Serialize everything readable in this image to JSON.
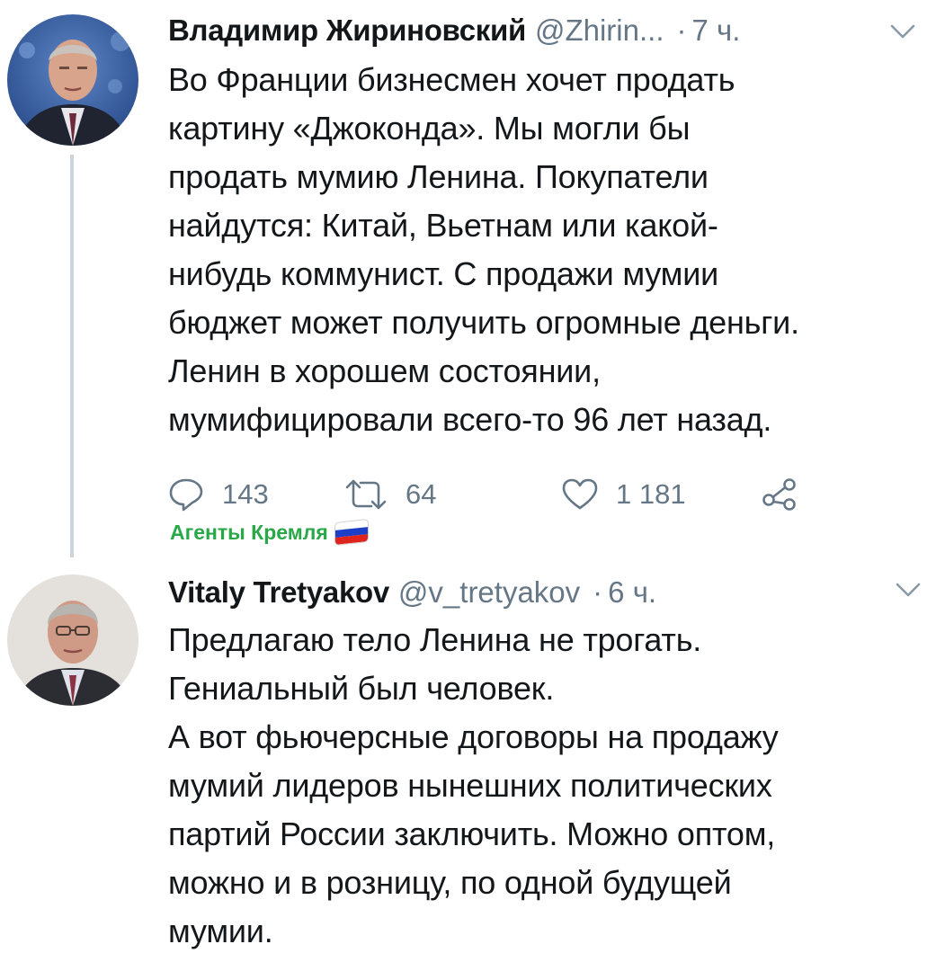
{
  "tweets": [
    {
      "display_name": "Владимир Жириновский",
      "handle": "@Zhirin...",
      "separator": "·",
      "time": "7 ч.",
      "text_lines": [
        "Во Франции бизнесмен хочет продать",
        "картину «Джоконда». Мы могли бы",
        "продать мумию Ленина. Покупатели",
        "найдутся: Китай, Вьетнам или какой-",
        "нибудь коммунист. С продажи мумии",
        "бюджет может получить огромные деньги.",
        "Ленин в хорошем состоянии,",
        "мумифицировали всего-то 96 лет назад."
      ],
      "reply_count": "143",
      "retweet_count": "64",
      "like_count": "1 181",
      "avatar_icon": "avatar-photo",
      "more_icon": "chevron-down-icon"
    },
    {
      "display_name": "Vitaly Tretyakov",
      "handle": "@v_tretyakov",
      "separator": "·",
      "time": "6 ч.",
      "text_lines": [
        "Предлагаю тело Ленина не трогать.",
        "Гениальный был человек.",
        "А вот фьючерсные договоры на продажу",
        "мумий лидеров нынешних политических",
        "партий России заключить. Можно оптом,",
        "можно и в розницу, по одной будущей",
        "мумии."
      ],
      "avatar_icon": "avatar-photo",
      "more_icon": "chevron-down-icon"
    }
  ],
  "watermark": {
    "label": "Агенты Кремля",
    "flag_icon": "russian-flag-icon",
    "color": "#29a848"
  },
  "colors": {
    "text": "#14171a",
    "secondary": "#657786",
    "thread_line": "#cdd5dc"
  }
}
